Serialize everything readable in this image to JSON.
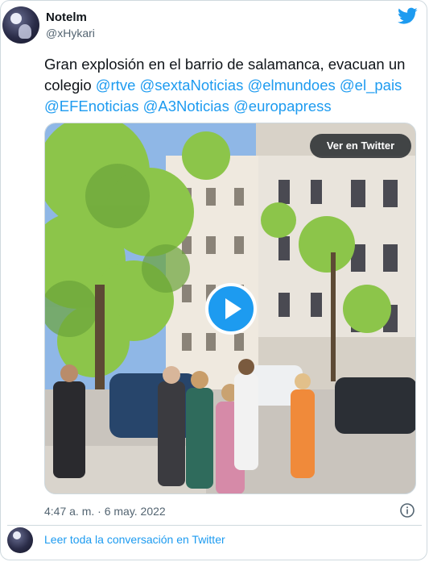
{
  "author": {
    "name": "Notelm",
    "handle": "@xHykari"
  },
  "tweet": {
    "text_prefix": "Gran explosión en el barrio de salamanca, evacuan un colegio ",
    "mentions": [
      "@rtve",
      "@sextaNoticias",
      "@elmundoes",
      "@el_pais",
      "@EFEnoticias",
      "@A3Noticias",
      "@europapress"
    ]
  },
  "media": {
    "view_button_label": "Ver en Twitter",
    "play_icon": "play-icon"
  },
  "meta": {
    "timestamp": "4:47 a. m. · 6 may. 2022",
    "info_icon": "info-icon"
  },
  "footer": {
    "read_conversation_label": "Leer toda la conversación en Twitter"
  },
  "colors": {
    "accent": "#1d9bf0",
    "text": "#0f1419",
    "secondary": "#536471",
    "border": "#cfd9de"
  }
}
